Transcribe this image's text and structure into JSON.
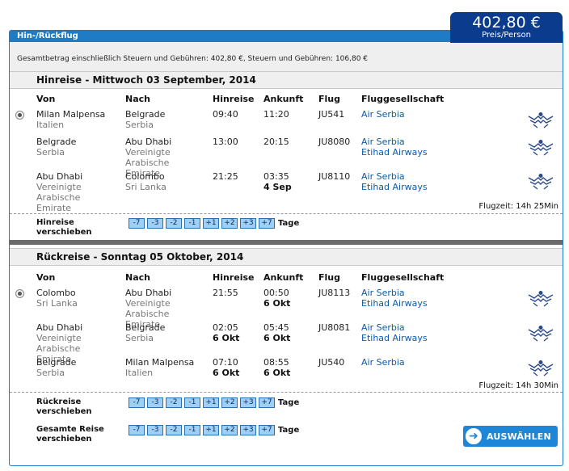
{
  "header": {
    "tab_title": "Hin-/Rückflug",
    "price": "402,80 €",
    "price_sub": "Preis/Person",
    "summary": "Gesamtbetrag einschließlich Steuern und Gebühren: 402,80 €, Steuern und Gebühren: 106,80 €"
  },
  "columns": {
    "from": "Von",
    "to": "Nach",
    "dep": "Hinreise",
    "arr": "Ankunft",
    "flight": "Flug",
    "airline": "Fluggesellschaft"
  },
  "outbound": {
    "title": "Hinreise - Mittwoch 03 September, 2014",
    "flugzeit": "Flugzeit: 14h 25Min",
    "segments": [
      {
        "from": "Milan Malpensa",
        "from_country": "Italien",
        "to": "Belgrade",
        "to_country": "Serbia",
        "dep": "09:40",
        "dep_day": "",
        "arr": "11:20",
        "arr_day": "",
        "flight": "JU541",
        "airline": "Air Serbia",
        "operator": ""
      },
      {
        "from": "Belgrade",
        "from_country": "Serbia",
        "to": "Abu Dhabi",
        "to_country": "Vereinigte Arabische Emirate",
        "dep": "13:00",
        "dep_day": "",
        "arr": "20:15",
        "arr_day": "",
        "flight": "JU8080",
        "airline": "Air Serbia",
        "operator": "Etihad Airways"
      },
      {
        "from": "Abu Dhabi",
        "from_country": "Vereinigte Arabische Emirate",
        "to": "Colombo",
        "to_country": "Sri Lanka",
        "dep": "21:25",
        "dep_day": "",
        "arr": "03:35",
        "arr_day": "4 Sep",
        "flight": "JU8110",
        "airline": "Air Serbia",
        "operator": "Etihad Airways"
      }
    ],
    "shift_label": "Hinreise verschieben"
  },
  "inbound": {
    "title": "Rückreise - Sonntag 05 Oktober, 2014",
    "flugzeit": "Flugzeit: 14h 30Min",
    "segments": [
      {
        "from": "Colombo",
        "from_country": "Sri Lanka",
        "to": "Abu Dhabi",
        "to_country": "Vereinigte Arabische Emirate",
        "dep": "21:55",
        "dep_day": "",
        "arr": "00:50",
        "arr_day": "6 Okt",
        "flight": "JU8113",
        "airline": "Air Serbia",
        "operator": "Etihad Airways"
      },
      {
        "from": "Abu Dhabi",
        "from_country": "Vereinigte Arabische Emirate",
        "to": "Belgrade",
        "to_country": "Serbia",
        "dep": "02:05",
        "dep_day": "6 Okt",
        "arr": "05:45",
        "arr_day": "6 Okt",
        "flight": "JU8081",
        "airline": "Air Serbia",
        "operator": "Etihad Airways"
      },
      {
        "from": "Belgrade",
        "from_country": "Serbia",
        "to": "Milan Malpensa",
        "to_country": "Italien",
        "dep": "07:10",
        "dep_day": "6 Okt",
        "arr": "08:55",
        "arr_day": "6 Okt",
        "flight": "JU540",
        "airline": "Air Serbia",
        "operator": ""
      }
    ],
    "shift_label": "Rückreise verschieben"
  },
  "total_shift_label": "Gesamte Reise verschieben",
  "shift_buttons": [
    "-7",
    "-3",
    "-2",
    "-1",
    "+1",
    "+2",
    "+3",
    "+7"
  ],
  "tage": "Tage",
  "select_button": "AUSWÄHLEN",
  "icons": {
    "logo": "air-serbia-logo-icon",
    "radio": "radio-selected-icon",
    "arrow": "arrow-right-icon"
  },
  "colors": {
    "accent": "#1e7bc6",
    "price_bg": "#0a3b8c",
    "link_blue": "#0b5aa8",
    "button_blue": "#1e86d6"
  }
}
